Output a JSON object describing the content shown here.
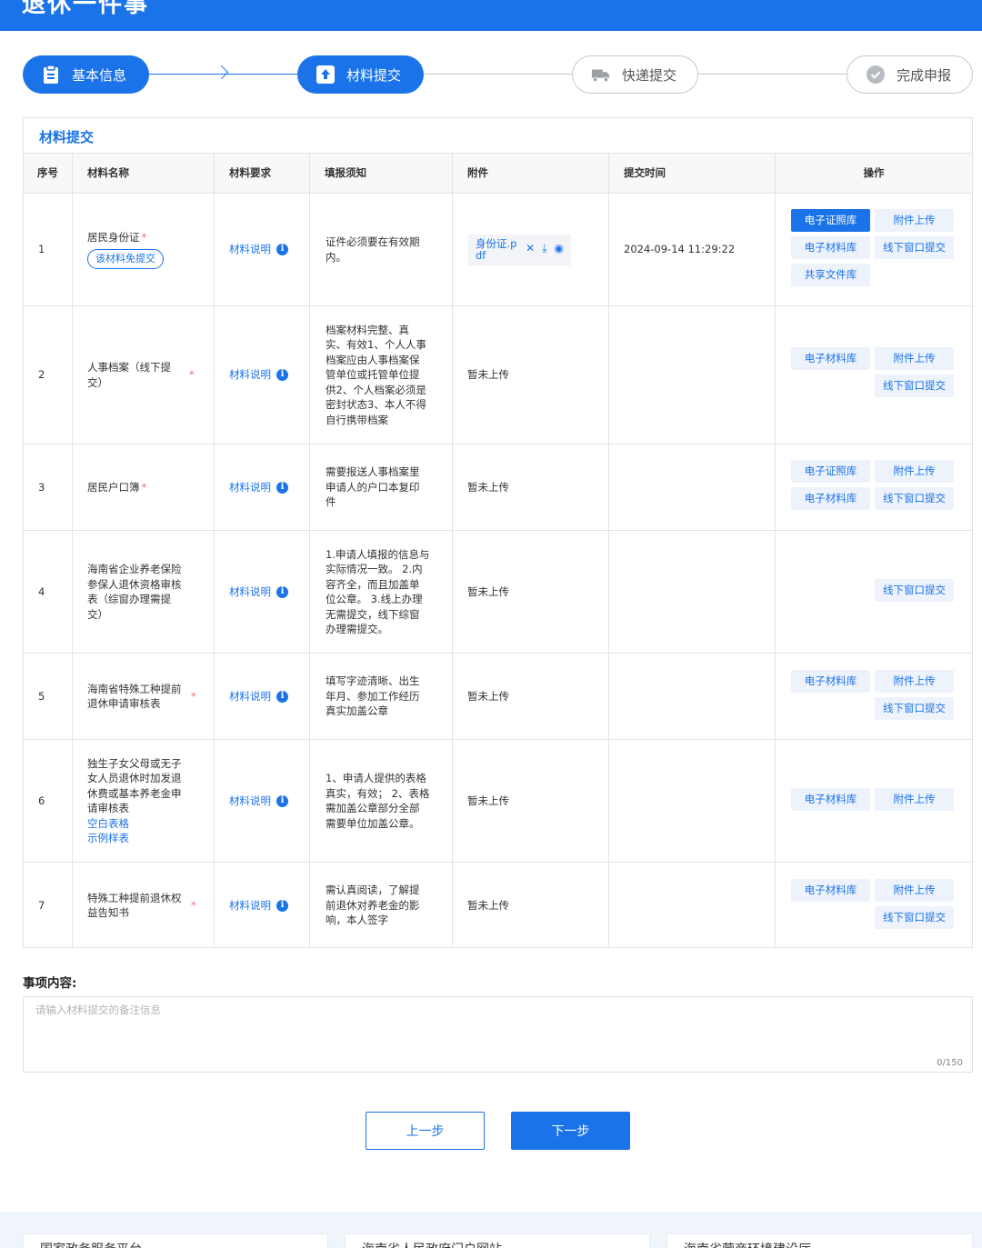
{
  "header": {
    "title": "退休一件事"
  },
  "steps": [
    {
      "label": "基本信息",
      "icon": "clipboard-icon",
      "state": "active"
    },
    {
      "label": "材料提交",
      "icon": "upload-icon",
      "state": "active"
    },
    {
      "label": "快递提交",
      "icon": "truck-icon",
      "state": "inactive"
    },
    {
      "label": "完成申报",
      "icon": "check-circle-icon",
      "state": "inactive"
    }
  ],
  "panel": {
    "title": "材料提交"
  },
  "table": {
    "headers": [
      "序号",
      "材料名称",
      "材料要求",
      "填报须知",
      "附件",
      "提交时间",
      "操作"
    ],
    "requirement_link": "材料说明",
    "rows": [
      {
        "index": "1",
        "name": "居民身份证",
        "required_mark": "*",
        "exempt_tag": "该材料免提交",
        "note": "证件必须要在有效期\n内。",
        "attachment": {
          "file_name": "身份证.pdf"
        },
        "time": "2024-09-14 11:29:22",
        "ops": [
          "电子证照库",
          "附件上传",
          "电子材料库",
          "线下窗口提交",
          "共享文件库"
        ]
      },
      {
        "index": "2",
        "name": "人事档案（线下提\n交）",
        "required_mark": "*",
        "note": "档案材料完整、真\n实、有效1、个人人事\n档案应由人事档案保\n管单位或托管单位提\n供2、个人档案必须是\n密封状态3、本人不得\n自行携带档案",
        "attachment_status": "暂未上传",
        "ops": [
          "电子材料库",
          "附件上传",
          "线下窗口提交"
        ]
      },
      {
        "index": "3",
        "name": "居民户口簿",
        "required_mark": "*",
        "note": "需要报送人事档案里\n申请人的户口本复印\n件",
        "attachment_status": "暂未上传",
        "ops": [
          "电子证照库",
          "附件上传",
          "电子材料库",
          "线下窗口提交"
        ]
      },
      {
        "index": "4",
        "name": "海南省企业养老保险\n参保人退休资格审核\n表（综窗办理需提\n交）",
        "note": "1.申请人填报的信息与\n实际情况一致。 2.内\n容齐全，而且加盖单\n位公章。 3.线上办理\n无需提交，线下综窗\n办理需提交。",
        "attachment_status": "暂未上传",
        "ops": [
          "线下窗口提交"
        ]
      },
      {
        "index": "5",
        "name": "海南省特殊工种提前\n退休申请审核表",
        "required_mark": "*",
        "note": "填写字迹清晰、出生\n年月、参加工作经历\n真实加盖公章",
        "attachment_status": "暂未上传",
        "ops": [
          "电子材料库",
          "附件上传",
          "线下窗口提交"
        ]
      },
      {
        "index": "6",
        "name": "独生子女父母或无子\n女人员退休时加发退\n休费或基本养老金申\n请审核表",
        "links": [
          "空白表格",
          "示例样表"
        ],
        "note": "1、申请人提供的表格\n真实，有效； 2、表格\n需加盖公章部分全部\n需要单位加盖公章。",
        "attachment_status": "暂未上传",
        "ops": [
          "电子材料库",
          "附件上传"
        ]
      },
      {
        "index": "7",
        "name": "特殊工种提前退休权\n益告知书",
        "required_mark": "*",
        "note": "需认真阅读，了解提\n前退休对养老金的影\n响，本人签字",
        "attachment_status": "暂未上传",
        "ops": [
          "电子材料库",
          "附件上传",
          "线下窗口提交"
        ]
      }
    ]
  },
  "remark": {
    "label": "事项内容:",
    "placeholder": "请输入材料提交的备注信息",
    "counter": "0/150"
  },
  "buttons": {
    "prev": "上一步",
    "next": "下一步"
  },
  "footer": {
    "links": [
      "国家政务服务平台",
      "海南省人民政府门户网站",
      "海南省营商环境建设厅"
    ]
  },
  "colors": {
    "primary": "#1a73e8",
    "required": "#f56c6c",
    "border": "#e3e3e3"
  }
}
